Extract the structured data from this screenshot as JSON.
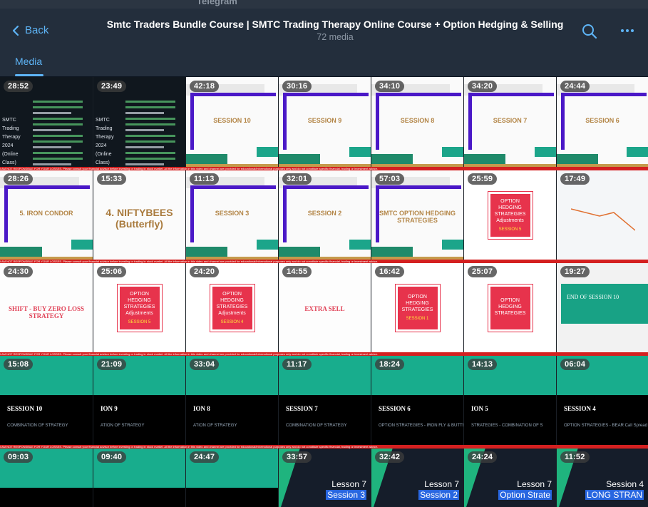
{
  "titlebar": {
    "title": "Telegram"
  },
  "header": {
    "back_label": "Back",
    "title": "Smtc Traders Bundle Course | SMTC Trading Therapy Online Course + Option Hedging & Selling",
    "subtitle": "72 media",
    "tabs": [
      {
        "label": "Media",
        "active": true
      }
    ]
  },
  "colors": {
    "accent": "#5eb5f7",
    "header_bg": "#232e3c",
    "ticker_red": "#d42020"
  },
  "ticker_text": "I AM NOT RESPONSIBLE FOR YOUR LOSSES. Please consult your financial advisor before investing or trading in stock market. All the information in this video and channel are provided for educational/informational purposes only and do not constitute specific financial, trading or investment advice.",
  "media": [
    {
      "duration": "28:52",
      "variant": "dark",
      "caption": "SMTC Trading Therapy 2024 (Online Class)"
    },
    {
      "duration": "23:49",
      "variant": "dark",
      "caption": "SMTC Trading Therapy 2024 (Online Class)"
    },
    {
      "duration": "42:18",
      "variant": "session",
      "caption": "SESSION 10"
    },
    {
      "duration": "30:16",
      "variant": "session",
      "caption": "SESSION 9"
    },
    {
      "duration": "34:10",
      "variant": "session",
      "caption": "SESSION 8"
    },
    {
      "duration": "34:20",
      "variant": "session",
      "caption": "SESSION 7"
    },
    {
      "duration": "24:44",
      "variant": "session",
      "caption": "SESSION 6"
    },
    {
      "duration": "28:26",
      "variant": "session",
      "caption": "5. IRON CONDOR"
    },
    {
      "duration": "15:33",
      "variant": "big",
      "caption": "4. NIFTYBEES (Butterfly)"
    },
    {
      "duration": "11:13",
      "variant": "session",
      "caption": "SESSION 3"
    },
    {
      "duration": "32:01",
      "variant": "session",
      "caption": "SESSION 2"
    },
    {
      "duration": "57:03",
      "variant": "session",
      "caption": "SMTC OPTION HEDGING STRATEGIES"
    },
    {
      "duration": "25:59",
      "variant": "red",
      "caption": "OPTION HEDGING STRATEGIES Adjustments",
      "sub": "SESSION 5"
    },
    {
      "duration": "17:49",
      "variant": "chart",
      "caption": ""
    },
    {
      "duration": "24:30",
      "variant": "plain",
      "caption": "SHIFT - BUY ZERO LOSS STRATEGY"
    },
    {
      "duration": "25:06",
      "variant": "red",
      "caption": "OPTION HEDGING STRATEGIES Adjustments",
      "sub": "SESSION 5"
    },
    {
      "duration": "24:20",
      "variant": "red",
      "caption": "OPTION HEDGING STRATEGIES Adjustments",
      "sub": "SESSION 4"
    },
    {
      "duration": "14:55",
      "variant": "plain",
      "caption": "EXTRA SELL"
    },
    {
      "duration": "16:42",
      "variant": "red",
      "caption": "OPTION HEDGING STRATEGIES",
      "sub": "SESSION 1"
    },
    {
      "duration": "25:07",
      "variant": "red",
      "caption": "OPTION HEDGING STRATEGIES",
      "sub": ""
    },
    {
      "duration": "19:27",
      "variant": "end",
      "caption": "END OF SESSION 10"
    },
    {
      "duration": "15:08",
      "variant": "teal",
      "caption": "SESSION 10",
      "sub": "COMBINATION OF STRATEGY"
    },
    {
      "duration": "21:09",
      "variant": "teal",
      "caption": "ION 9",
      "sub": "ATION OF STRATEGY"
    },
    {
      "duration": "33:04",
      "variant": "teal",
      "caption": "ION 8",
      "sub": "ATION OF STRATEGY"
    },
    {
      "duration": "11:17",
      "variant": "teal",
      "caption": "SESSION 7",
      "sub": "COMBINATION OF STRATEGY"
    },
    {
      "duration": "18:24",
      "variant": "teal",
      "caption": "SESSION 6",
      "sub": "OPTION STRATEGIES - IRON FLY & BUTTERFLY"
    },
    {
      "duration": "14:13",
      "variant": "teal",
      "caption": "ION 5",
      "sub": "STRATEGIES - COMBINATION OF S"
    },
    {
      "duration": "06:04",
      "variant": "teal",
      "caption": "SESSION 4",
      "sub": "OPTION STRATEGIES - BEAR Call Spread"
    },
    {
      "duration": "09:03",
      "variant": "teal",
      "caption": "",
      "sub": ""
    },
    {
      "duration": "09:40",
      "variant": "teal",
      "caption": "",
      "sub": ""
    },
    {
      "duration": "24:47",
      "variant": "teal",
      "caption": "",
      "sub": ""
    },
    {
      "duration": "33:57",
      "variant": "lesson",
      "caption": "Lesson 7",
      "hl": "Session 3"
    },
    {
      "duration": "32:42",
      "variant": "lesson",
      "caption": "Lesson 7",
      "hl": "Session 2"
    },
    {
      "duration": "24:24",
      "variant": "lesson",
      "caption": "Lesson 7",
      "hl": "Option Strate"
    },
    {
      "duration": "11:52",
      "variant": "lesson",
      "caption": "Session 4",
      "hl": "LONG STRAN"
    }
  ]
}
